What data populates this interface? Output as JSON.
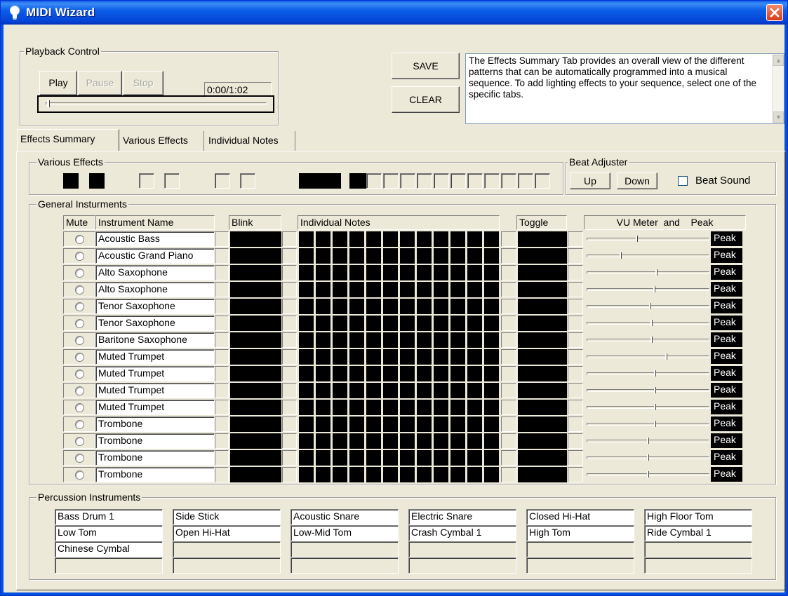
{
  "window": {
    "title": "MIDI Wizard"
  },
  "playback": {
    "group_label": "Playback Control",
    "play": "Play",
    "pause": "Pause",
    "stop": "Stop",
    "time": "0:00/1:02",
    "progress_fraction": 0.0
  },
  "actions": {
    "save": "SAVE",
    "clear": "CLEAR"
  },
  "description": "The Effects Summary Tab provides an overall view of the different patterns that can be automatically programmed into a musical sequence. To add lighting effects to your sequence, select one of the specific tabs.",
  "tabs": [
    {
      "label": "Effects Summary",
      "active": true
    },
    {
      "label": "Various Effects",
      "active": false
    },
    {
      "label": "Individual Notes",
      "active": false
    }
  ],
  "various_effects": {
    "label": "Various Effects",
    "states": [
      true,
      true,
      false,
      false,
      false,
      false,
      true,
      true,
      true,
      false,
      false,
      false,
      false,
      false,
      false,
      false,
      false,
      false,
      false,
      false,
      false
    ]
  },
  "beat_adjuster": {
    "label": "Beat Adjuster",
    "up": "Up",
    "down": "Down",
    "beat_sound": "Beat Sound",
    "beat_sound_checked": false
  },
  "general": {
    "label": "General Insturments",
    "headers": {
      "mute": "Mute",
      "name": "Instrument Name",
      "blink": "Blink",
      "notes": "Individual Notes",
      "toggle": "Toggle",
      "vu": "VU Meter  and    Peak"
    },
    "peak_label": "Peak",
    "instruments": [
      {
        "name": "Acoustic Bass",
        "vu": 0.4
      },
      {
        "name": "Acoustic Grand Piano",
        "vu": 0.27
      },
      {
        "name": "Alto Saxophone",
        "vu": 0.56
      },
      {
        "name": "Alto Saxophone",
        "vu": 0.54
      },
      {
        "name": "Tenor Saxophone",
        "vu": 0.51
      },
      {
        "name": "Tenor Saxophone",
        "vu": 0.52
      },
      {
        "name": "Baritone Saxophone",
        "vu": 0.52
      },
      {
        "name": "Muted Trumpet",
        "vu": 0.64
      },
      {
        "name": "Muted Trumpet",
        "vu": 0.55
      },
      {
        "name": "Muted Trumpet",
        "vu": 0.55
      },
      {
        "name": "Muted Trumpet",
        "vu": 0.55
      },
      {
        "name": "Trombone",
        "vu": 0.55
      },
      {
        "name": "Trombone",
        "vu": 0.49
      },
      {
        "name": "Trombone",
        "vu": 0.49
      },
      {
        "name": "Trombone",
        "vu": 0.49
      }
    ]
  },
  "percussion": {
    "label": "Percussion Instruments",
    "columns": [
      [
        "Bass Drum 1",
        "Low Tom",
        "Chinese Cymbal",
        ""
      ],
      [
        "Side Stick",
        "Open Hi-Hat",
        "",
        ""
      ],
      [
        "Acoustic Snare",
        "Low-Mid Tom",
        "",
        ""
      ],
      [
        "Electric Snare",
        "Crash Cymbal 1",
        "",
        ""
      ],
      [
        "Closed Hi-Hat",
        "High Tom",
        "",
        ""
      ],
      [
        "High Floor Tom",
        "Ride Cymbal 1",
        "",
        ""
      ]
    ]
  }
}
